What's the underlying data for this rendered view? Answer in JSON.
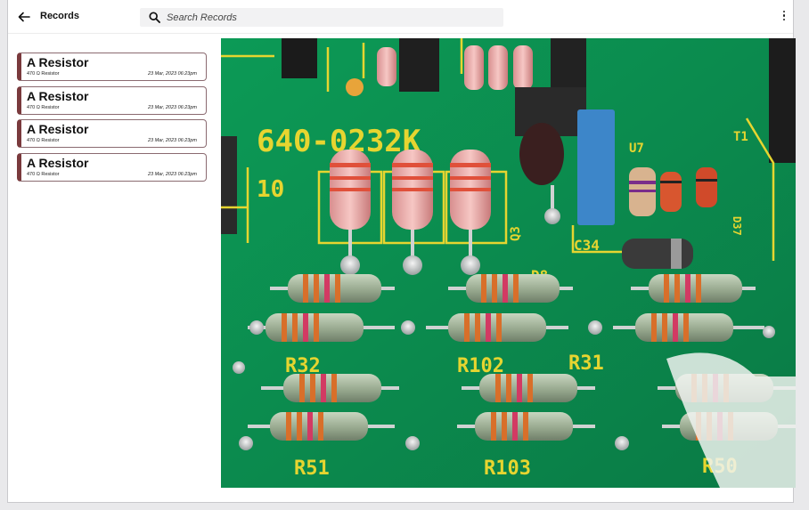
{
  "header": {
    "back_icon": "arrow-left-icon",
    "title": "Records",
    "search": {
      "placeholder": "Search Records",
      "value": "",
      "icon": "search-icon"
    },
    "menu_icon": "more-vertical-icon"
  },
  "records": [
    {
      "name": "A Resistor",
      "detail": "470 Ω  Resistor",
      "date": "23 Mar, 2023 06:23pm"
    },
    {
      "name": "A Resistor",
      "detail": "470 Ω  Resistor",
      "date": "23 Mar, 2023 06:23pm"
    },
    {
      "name": "A Resistor",
      "detail": "470 Ω  Resistor",
      "date": "23 Mar, 2023 06:23pm"
    },
    {
      "name": "A Resistor",
      "detail": "470 Ω  Resistor",
      "date": "23 Mar, 2023 06:23pm"
    }
  ],
  "photo": {
    "board_labels": [
      "640-0232K",
      "10",
      "R32",
      "R102",
      "R31",
      "R51",
      "R103",
      "R50",
      "C34",
      "U7",
      "T1",
      "D8",
      "D37",
      "Q3"
    ]
  },
  "colors": {
    "accent": "#7a3a3d",
    "board": "#0f8f52",
    "silkscreen": "#e6d530"
  }
}
